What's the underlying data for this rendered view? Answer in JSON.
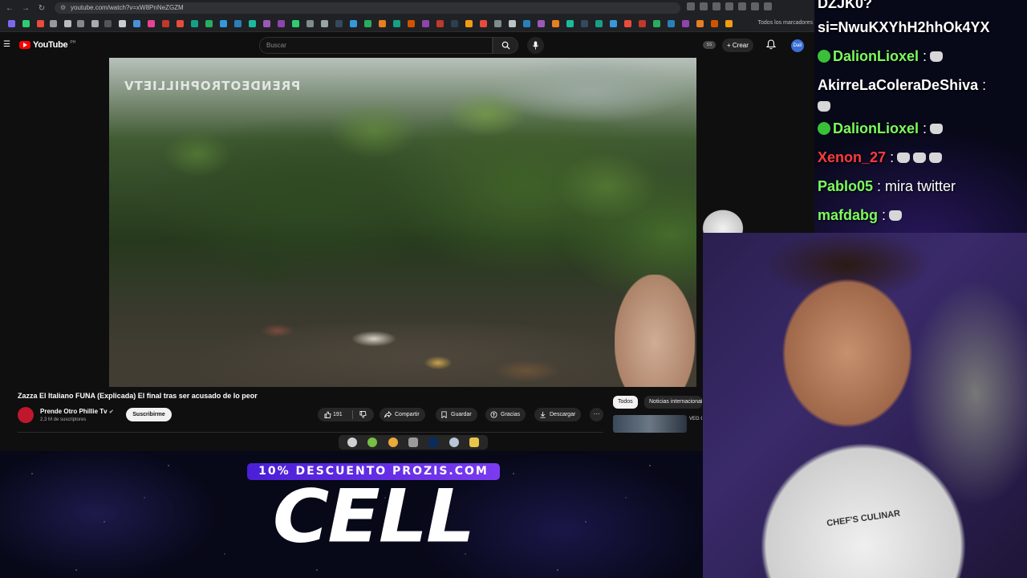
{
  "browser": {
    "url": "youtube.com/watch?v=xW8PnNeZGZM",
    "bookmarks_folder": "Todos los marcadores"
  },
  "youtube": {
    "logo": "YouTube",
    "logo_region": "PH",
    "search_placeholder": "Buscar",
    "header_badge": "SS",
    "create_label": "Crear",
    "avatar_label": "Dalí"
  },
  "video": {
    "watermark": "PRENDEOTROPHILLIETV",
    "title": "Zazza El Italiano FUNA (Explicada) El final tras ser acusado de lo peor",
    "channel_name": "Prende Otro Phillie Tv",
    "subscribers": "2,3 M de suscriptores",
    "subscribe_label": "Suscribirme",
    "likes": "191",
    "share_label": "Compartir",
    "save_label": "Guardar",
    "thanks_label": "Gracias",
    "download_label": "Descargar",
    "more_label": "···"
  },
  "recommendations": {
    "chips": [
      "Todos",
      "Noticias internacionales"
    ],
    "rec_text": "VEG COU"
  },
  "promo": {
    "banner": "10% DESCUENTO PROZIS.COM",
    "code": "CELL"
  },
  "chat": {
    "lines": [
      {
        "user": "DZJK0?",
        "msg": ""
      },
      {
        "user": "si=NwuKXYhH2hhOk4YX",
        "msg": ""
      },
      {
        "user": "DalionLioxel",
        "msg": ":"
      },
      {
        "user": "AkirreLaColeraDeShiva",
        "msg": ":"
      },
      {
        "user": "DalionLioxel",
        "msg": ":"
      },
      {
        "user": "Xenon_27",
        "msg": ":"
      },
      {
        "user": "Pablo05",
        "msg": ": mira twitter"
      },
      {
        "user": "mafdabg",
        "msg": ":"
      }
    ],
    "colors": {
      "DalionLioxel": "#7CFC5C",
      "AkirreLaColeraDeShiva": "#FFFFFF",
      "Xenon_27": "#FF3B3B",
      "Pablo05": "#7CFC5C",
      "mafdabg": "#7CFC5C"
    },
    "emote_multiplier": "x5"
  },
  "webcam": {
    "shirt_text": "CHEF'S CULINAR"
  }
}
